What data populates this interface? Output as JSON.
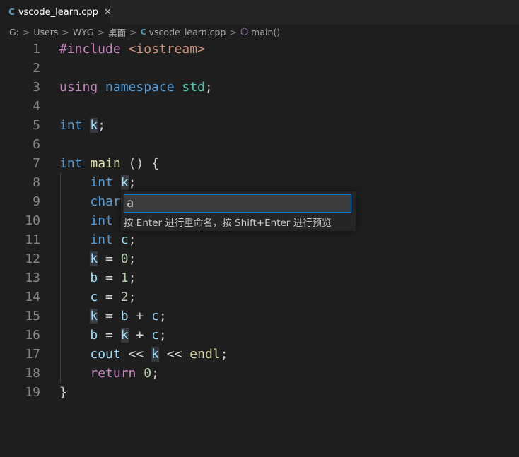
{
  "tab": {
    "icon": "C",
    "label": "vscode_learn.cpp",
    "close": "✕"
  },
  "breadcrumb": {
    "items": [
      "G:",
      "Users",
      "WYG",
      "桌面"
    ],
    "file": "vscode_learn.cpp",
    "symbol": "main()",
    "separator": ">"
  },
  "editor": {
    "lines": [
      {
        "n": "1",
        "tokens": [
          {
            "t": "#include ",
            "c": "ctrl"
          },
          {
            "t": "<iostream>",
            "c": "str"
          }
        ]
      },
      {
        "n": "2",
        "tokens": []
      },
      {
        "n": "3",
        "tokens": [
          {
            "t": "using ",
            "c": "ctrl"
          },
          {
            "t": "namespace ",
            "c": "kw"
          },
          {
            "t": "std",
            "c": "type"
          },
          {
            "t": ";",
            "c": ""
          }
        ]
      },
      {
        "n": "4",
        "tokens": []
      },
      {
        "n": "5",
        "tokens": [
          {
            "t": "int ",
            "c": "kw"
          },
          {
            "t": "k",
            "c": "var hl"
          },
          {
            "t": ";",
            "c": ""
          }
        ]
      },
      {
        "n": "6",
        "tokens": []
      },
      {
        "n": "7",
        "tokens": [
          {
            "t": "int ",
            "c": "kw"
          },
          {
            "t": "main",
            "c": "fn"
          },
          {
            "t": " () {",
            "c": ""
          }
        ]
      },
      {
        "n": "8",
        "tokens": [
          {
            "t": "    ",
            "c": ""
          },
          {
            "t": "int ",
            "c": "kw"
          },
          {
            "t": "k",
            "c": "var hl"
          },
          {
            "t": ";",
            "c": ""
          }
        ]
      },
      {
        "n": "9",
        "tokens": [
          {
            "t": "    ",
            "c": ""
          },
          {
            "t": "char",
            "c": "kw"
          }
        ]
      },
      {
        "n": "10",
        "tokens": [
          {
            "t": "    ",
            "c": ""
          },
          {
            "t": "int",
            "c": "kw"
          }
        ]
      },
      {
        "n": "11",
        "tokens": [
          {
            "t": "    ",
            "c": ""
          },
          {
            "t": "int ",
            "c": "kw"
          },
          {
            "t": "c",
            "c": "var"
          },
          {
            "t": ";",
            "c": ""
          }
        ]
      },
      {
        "n": "12",
        "tokens": [
          {
            "t": "    ",
            "c": ""
          },
          {
            "t": "k",
            "c": "var hl"
          },
          {
            "t": " = ",
            "c": ""
          },
          {
            "t": "0",
            "c": "num"
          },
          {
            "t": ";",
            "c": ""
          }
        ]
      },
      {
        "n": "13",
        "tokens": [
          {
            "t": "    ",
            "c": ""
          },
          {
            "t": "b",
            "c": "var"
          },
          {
            "t": " = ",
            "c": ""
          },
          {
            "t": "1",
            "c": "num"
          },
          {
            "t": ";",
            "c": ""
          }
        ]
      },
      {
        "n": "14",
        "tokens": [
          {
            "t": "    ",
            "c": ""
          },
          {
            "t": "c",
            "c": "var"
          },
          {
            "t": " = ",
            "c": ""
          },
          {
            "t": "2",
            "c": "num"
          },
          {
            "t": ";",
            "c": ""
          }
        ]
      },
      {
        "n": "15",
        "tokens": [
          {
            "t": "    ",
            "c": ""
          },
          {
            "t": "k",
            "c": "var hl"
          },
          {
            "t": " = ",
            "c": ""
          },
          {
            "t": "b",
            "c": "var"
          },
          {
            "t": " + ",
            "c": ""
          },
          {
            "t": "c",
            "c": "var"
          },
          {
            "t": ";",
            "c": ""
          }
        ]
      },
      {
        "n": "16",
        "tokens": [
          {
            "t": "    ",
            "c": ""
          },
          {
            "t": "b",
            "c": "var"
          },
          {
            "t": " = ",
            "c": ""
          },
          {
            "t": "k",
            "c": "var hl"
          },
          {
            "t": " + ",
            "c": ""
          },
          {
            "t": "c",
            "c": "var"
          },
          {
            "t": ";",
            "c": ""
          }
        ]
      },
      {
        "n": "17",
        "tokens": [
          {
            "t": "    ",
            "c": ""
          },
          {
            "t": "cout",
            "c": "var"
          },
          {
            "t": " << ",
            "c": ""
          },
          {
            "t": "k",
            "c": "var hl"
          },
          {
            "t": " << ",
            "c": ""
          },
          {
            "t": "endl",
            "c": "fn"
          },
          {
            "t": ";",
            "c": ""
          }
        ]
      },
      {
        "n": "18",
        "tokens": [
          {
            "t": "    ",
            "c": ""
          },
          {
            "t": "return ",
            "c": "ctrl"
          },
          {
            "t": "0",
            "c": "num"
          },
          {
            "t": ";",
            "c": ""
          }
        ]
      },
      {
        "n": "19",
        "tokens": [
          {
            "t": "}",
            "c": ""
          }
        ]
      }
    ]
  },
  "rename_widget": {
    "value": "a",
    "hint": "按 Enter 进行重命名，按 Shift+Enter 进行预览"
  }
}
